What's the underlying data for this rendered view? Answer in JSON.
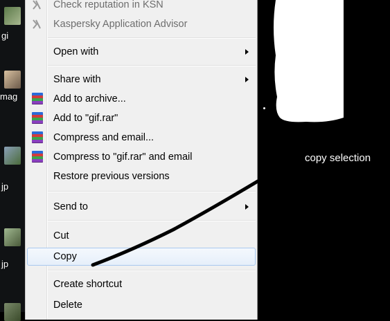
{
  "desktop": {
    "labels": [
      "gi",
      "mag",
      "jp",
      "jp"
    ]
  },
  "menu": {
    "items": [
      {
        "label": "Check reputation in KSN",
        "disabled": true,
        "icon": "kaspersky-icon"
      },
      {
        "label": "Kaspersky Application Advisor",
        "disabled": true,
        "icon": "kaspersky-icon"
      },
      {
        "label": "Open with",
        "submenu": true
      },
      {
        "label": "Share with",
        "submenu": true
      },
      {
        "label": "Add to archive...",
        "icon": "winrar-icon"
      },
      {
        "label": "Add to \"gif.rar\"",
        "icon": "winrar-icon"
      },
      {
        "label": "Compress and email...",
        "icon": "winrar-icon"
      },
      {
        "label": "Compress to \"gif.rar\" and email",
        "icon": "winrar-icon"
      },
      {
        "label": "Restore previous versions"
      },
      {
        "label": "Send to",
        "submenu": true
      },
      {
        "label": "Cut"
      },
      {
        "label": "Copy",
        "highlighted": true
      },
      {
        "label": "Create shortcut"
      },
      {
        "label": "Delete"
      }
    ]
  },
  "annotation": {
    "text": "copy selection"
  },
  "colors": {
    "menu_bg": "#f0f0f0",
    "highlight_border": "#a8c8ef",
    "background": "#000000",
    "winrar_stack": [
      "#2a6bd8",
      "#d23b3b",
      "#3aa54a",
      "#8a3fbf"
    ]
  }
}
